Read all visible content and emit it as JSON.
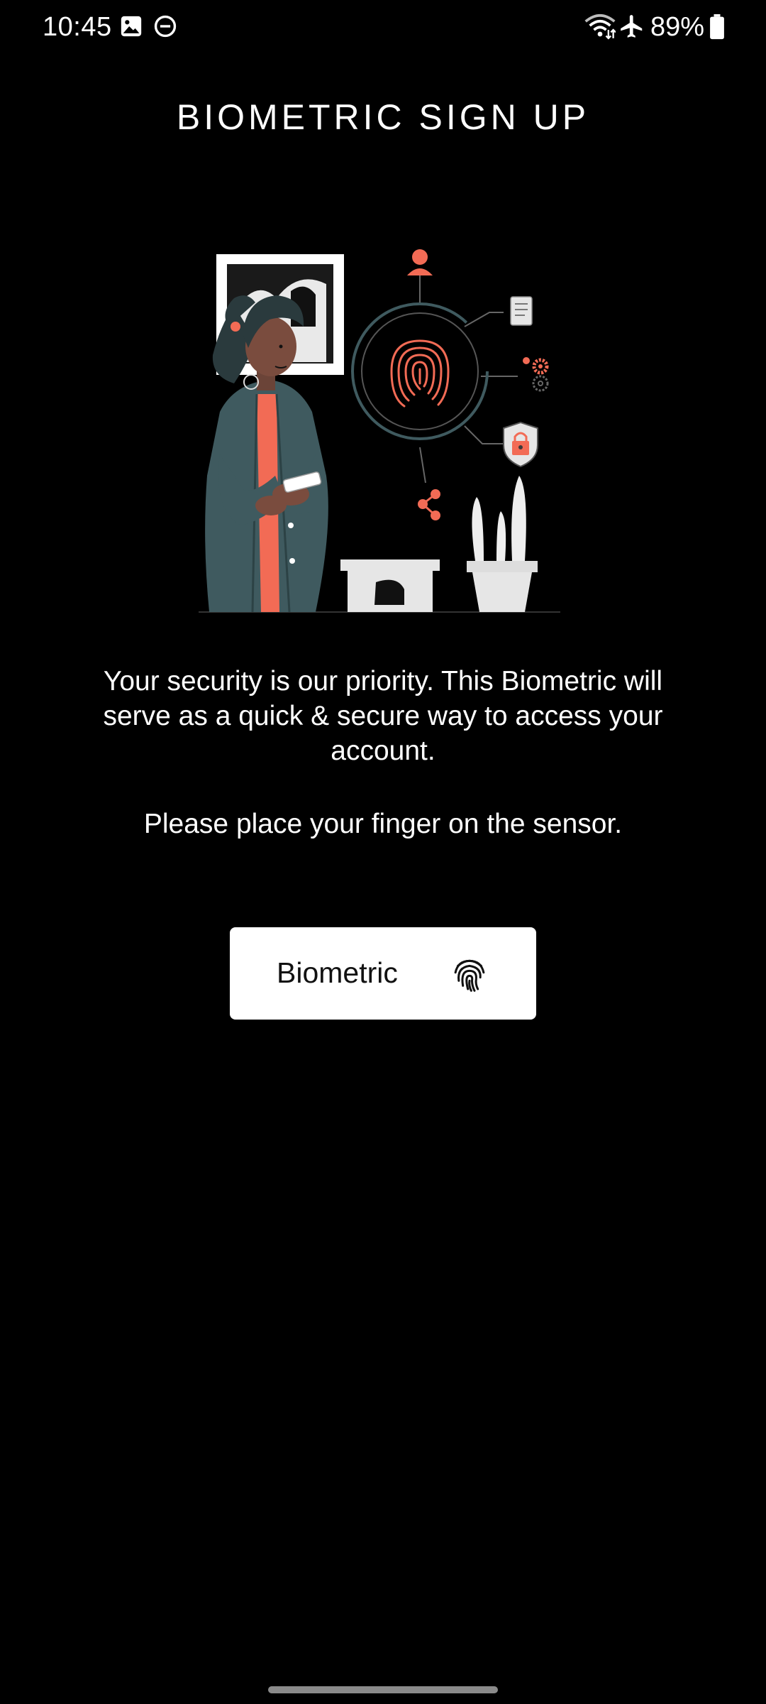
{
  "status_bar": {
    "time": "10:45",
    "battery_percent": "89%",
    "icons": [
      "image-icon",
      "do-not-disturb-icon",
      "wifi-icon",
      "airplane-mode-icon",
      "battery-icon"
    ]
  },
  "page": {
    "title": "BIOMETRIC SIGN UP",
    "description": "Your security is our priority. This Biometric will serve as a quick & secure way to access your account.",
    "instruction": "Please place your finger on the sensor."
  },
  "illustration": {
    "name": "woman-using-phone-fingerprint-illustration",
    "accent_color": "#F26B55",
    "jacket_color": "#3F5A5F"
  },
  "button": {
    "label": "Biometric",
    "icon": "fingerprint-icon",
    "background": "#FFFFFF"
  },
  "colors": {
    "background": "#000000",
    "text": "#FFFFFF"
  }
}
